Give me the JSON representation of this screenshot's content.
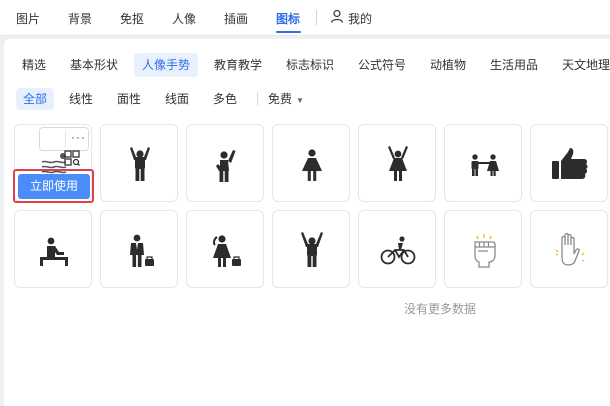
{
  "top_nav": {
    "items": [
      "图片",
      "背景",
      "免抠",
      "人像",
      "插画",
      "图标"
    ],
    "active": "图标",
    "user_label": "我的"
  },
  "categories": [
    "精选",
    "基本形状",
    "人像手势",
    "教育教学",
    "标志标识",
    "公式符号",
    "动植物",
    "生活用品",
    "天文地理"
  ],
  "active_category": "人像手势",
  "styles": [
    "全部",
    "线性",
    "面性",
    "线面",
    "多色"
  ],
  "active_style": "全部",
  "price_filter": "免费",
  "card_actions": {
    "use_label": "立即使用",
    "more_label": "···"
  },
  "icons": [
    "person-swimming-icon",
    "person-arms-up-icon",
    "person-waving-icon",
    "woman-standing-icon",
    "woman-cheering-icon",
    "boy-girl-holding-hands-icon",
    "thumbs-up-icon",
    "person-reading-at-desk-icon",
    "businessman-with-bag-icon",
    "woman-with-bag-icon",
    "person-cheering-icon",
    "person-cycling-icon",
    "raised-fist-icon",
    "raised-hand-icon"
  ],
  "empty_message": "没有更多数据",
  "colors": {
    "accent": "#2f6fe8",
    "button": "#4b8df8",
    "highlight": "#e0424d",
    "icon": "#2c2c2c"
  }
}
